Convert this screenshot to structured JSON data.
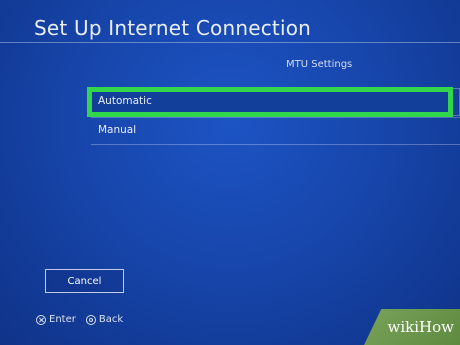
{
  "header": {
    "title": "Set Up Internet Connection"
  },
  "section": {
    "title": "MTU Settings"
  },
  "options": [
    {
      "label": "Automatic",
      "selected": true
    },
    {
      "label": "Manual",
      "selected": false
    }
  ],
  "buttons": {
    "cancel_label": "Cancel"
  },
  "footer": {
    "hints": [
      {
        "icon": "cross-button-icon",
        "label": "Enter"
      },
      {
        "icon": "circle-button-icon",
        "label": "Back"
      }
    ]
  },
  "watermark": {
    "text": "wikiHow"
  },
  "colors": {
    "background": "#1746ac",
    "focus_highlight": "#32d64c",
    "selected_row": "#123f9a"
  }
}
